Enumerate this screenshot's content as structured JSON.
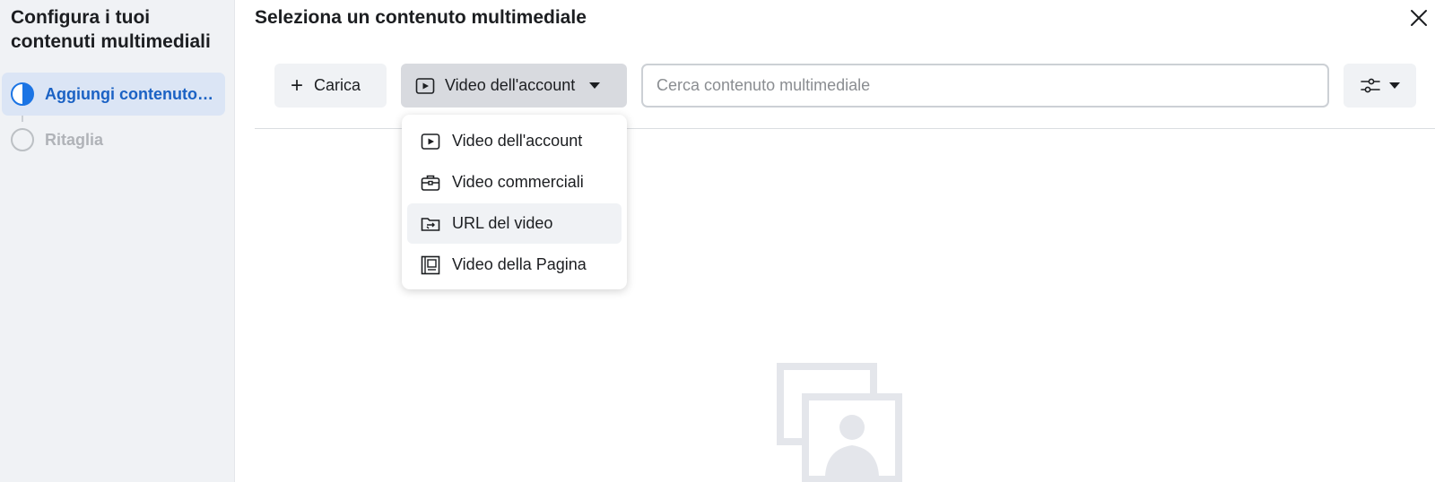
{
  "sidebar": {
    "title": "Configura i tuoi contenuti multimediali",
    "steps": [
      {
        "label": "Aggiungi contenuto multimediale",
        "state": "active"
      },
      {
        "label": "Ritaglia",
        "state": "inactive"
      }
    ]
  },
  "main": {
    "title": "Seleziona un contenuto multimediale",
    "close_icon": "close-icon"
  },
  "toolbar": {
    "upload_label": "Carica",
    "source_selected": "Video dell'account",
    "search_placeholder": "Cerca contenuto multimediale",
    "search_value": "",
    "filter_icon": "sliders-icon"
  },
  "dropdown": {
    "items": [
      {
        "label": "Video dell'account",
        "icon": "play-icon"
      },
      {
        "label": "Video commerciali",
        "icon": "briefcase-icon"
      },
      {
        "label": "URL del video",
        "icon": "folder-link-icon",
        "highlighted": true
      },
      {
        "label": "Video della Pagina",
        "icon": "page-icon"
      }
    ]
  },
  "colors": {
    "accent": "#1b74e4",
    "sidebar_bg": "#f0f2f5",
    "active_step_bg": "#dbe5f5"
  }
}
